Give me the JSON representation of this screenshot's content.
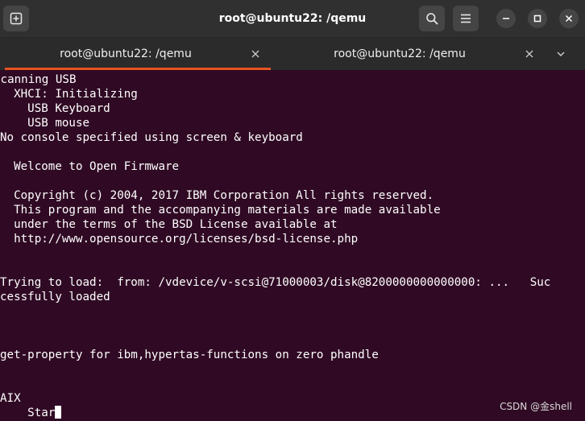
{
  "window": {
    "title": "root@ubuntu22: /qemu"
  },
  "headerbar": {
    "new_tab_icon": "new-tab-icon",
    "search_icon": "search-icon",
    "menu_icon": "hamburger-menu-icon",
    "minimize_icon": "minimize-icon",
    "maximize_icon": "maximize-icon",
    "close_icon": "close-icon"
  },
  "tabs": [
    {
      "label": "root@ubuntu22: /qemu",
      "active": true
    },
    {
      "label": "root@ubuntu22: /qemu",
      "active": false
    }
  ],
  "colors": {
    "terminal_bg": "#300a24",
    "terminal_fg": "#ffffff",
    "headerbar_bg": "#303030",
    "tabbar_bg": "#2b2b2b",
    "accent": "#e95420"
  },
  "terminal": {
    "lines": [
      "Scanning USB",
      "  XHCI: Initializing",
      "    USB Keyboard",
      "    USB mouse",
      "No console specified using screen & keyboard",
      "",
      "  Welcome to Open Firmware",
      "",
      "  Copyright (c) 2004, 2017 IBM Corporation All rights reserved.",
      "  This program and the accompanying materials are made available",
      "  under the terms of the BSD License available at",
      "  http://www.opensource.org/licenses/bsd-license.php",
      "",
      "",
      "Trying to load:  from: /vdevice/v-scsi@71000003/disk@8200000000000000: ...   Suc",
      "cessfully loaded",
      "",
      "",
      "",
      "get-property for ibm,hypertas-functions on zero phandle",
      "",
      "",
      "AIX",
      "    Star"
    ]
  },
  "watermark": "CSDN @金shell"
}
